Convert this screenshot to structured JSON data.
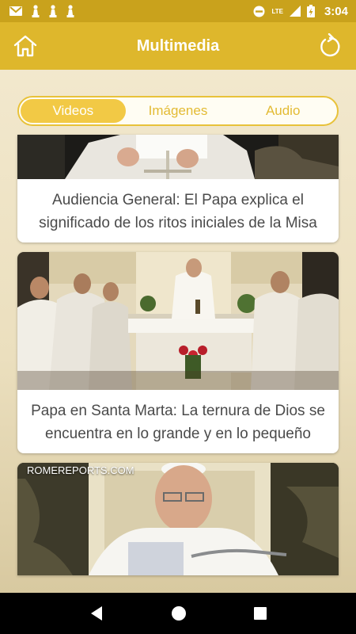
{
  "status_bar": {
    "time": "3:04",
    "network": "LTE",
    "icons": [
      "gmail-icon",
      "chess-pawn-icon",
      "chess-pawn-icon",
      "chess-pawn-icon",
      "do-not-disturb-icon",
      "signal-icon",
      "battery-charging-icon"
    ]
  },
  "app_bar": {
    "title": "Multimedia",
    "left_icon": "home-icon",
    "right_icon": "refresh-icon"
  },
  "tabs": [
    {
      "label": "Videos",
      "active": true
    },
    {
      "label": "Imágenes",
      "active": false
    },
    {
      "label": "Audio",
      "active": false
    }
  ],
  "videos": [
    {
      "title": "Audiencia General: El Papa explica el significado de los ritos iniciales de la Misa"
    },
    {
      "title": "Papa en Santa Marta: La ternura de Dios se encuentra en lo grande y en lo pequeño"
    },
    {
      "watermark": "ROMEREPORTS.COM",
      "title": ""
    }
  ],
  "colors": {
    "status_bar": "#c9a21c",
    "app_bar": "#deb72c",
    "tab_active": "#f2c945",
    "tab_text": "#e3bb34",
    "background": "#efe4c6"
  },
  "nav_bar": {
    "buttons": [
      "back-icon",
      "home-circle-icon",
      "recents-icon"
    ]
  }
}
